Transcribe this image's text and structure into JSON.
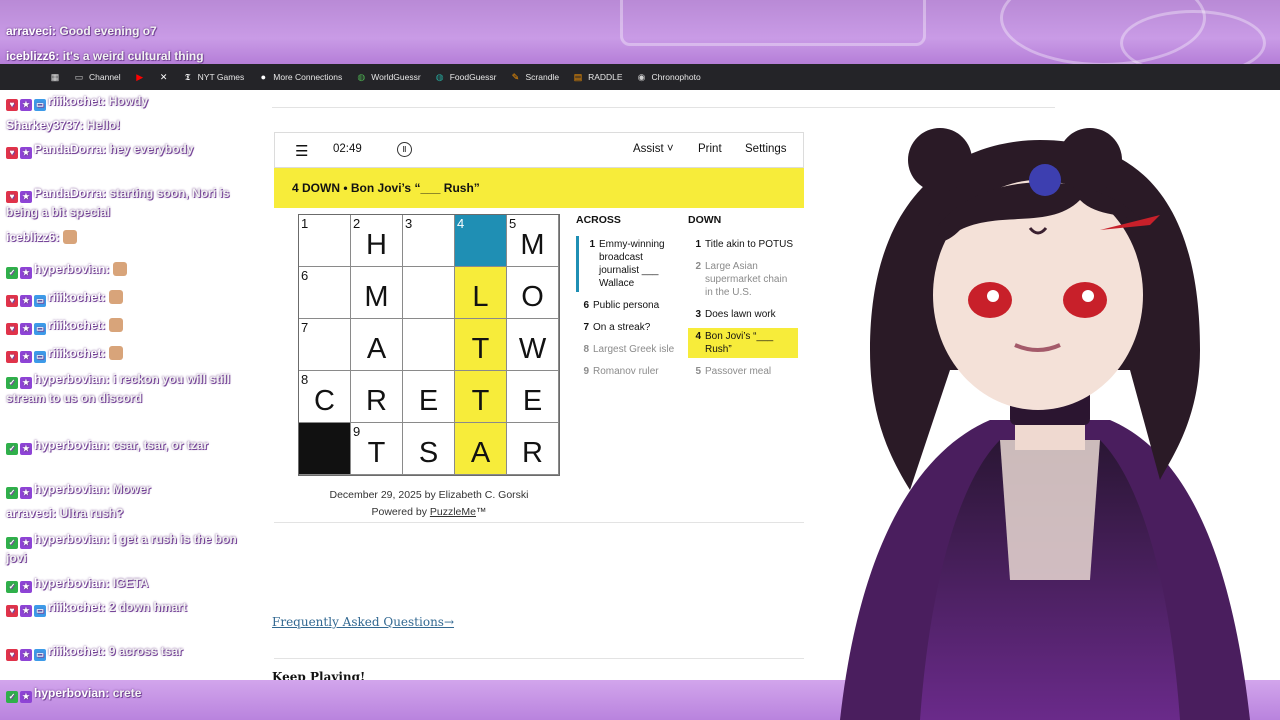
{
  "bookmarks": [
    {
      "icon": "folder-icon",
      "label": "Channel",
      "color": "#cfcfcf"
    },
    {
      "icon": "youtube-icon",
      "label": "",
      "color": "#ff0000"
    },
    {
      "icon": "x-icon",
      "label": "",
      "color": "#ffffff"
    },
    {
      "icon": "nyt-icon",
      "label": "NYT Games",
      "color": "#ffffff"
    },
    {
      "icon": "dot-icon",
      "label": "More Connections",
      "color": "#ffffff"
    },
    {
      "icon": "globe-icon",
      "label": "WorldGuessr",
      "color": "#4caf50"
    },
    {
      "icon": "globe-icon",
      "label": "FoodGuessr",
      "color": "#26a69a"
    },
    {
      "icon": "pen-icon",
      "label": "Scrandle",
      "color": "#ff9800"
    },
    {
      "icon": "raddle-icon",
      "label": "RADDLE",
      "color": "#ff9800"
    },
    {
      "icon": "camera-icon",
      "label": "Chronophoto",
      "color": "#cfcfcf"
    }
  ],
  "toolbar": {
    "timer": "02:49",
    "assist": "Assist ˅",
    "print": "Print",
    "settings": "Settings"
  },
  "clue_bar": "4 DOWN  •  Bon Jovi’s “___ Rush”",
  "grid": {
    "rows": [
      [
        {
          "n": "1",
          "l": "",
          "s": ""
        },
        {
          "n": "2",
          "l": "H",
          "s": ""
        },
        {
          "n": "3",
          "l": "",
          "s": ""
        },
        {
          "n": "4",
          "l": "",
          "s": "sel"
        },
        {
          "n": "5",
          "l": "M",
          "s": ""
        }
      ],
      [
        {
          "n": "6",
          "l": "",
          "s": ""
        },
        {
          "n": "",
          "l": "M",
          "s": ""
        },
        {
          "n": "",
          "l": "",
          "s": ""
        },
        {
          "n": "",
          "l": "L",
          "s": "hl"
        },
        {
          "n": "",
          "l": "O",
          "s": ""
        }
      ],
      [
        {
          "n": "7",
          "l": "",
          "s": ""
        },
        {
          "n": "",
          "l": "A",
          "s": ""
        },
        {
          "n": "",
          "l": "",
          "s": ""
        },
        {
          "n": "",
          "l": "T",
          "s": "hl"
        },
        {
          "n": "",
          "l": "W",
          "s": ""
        }
      ],
      [
        {
          "n": "8",
          "l": "C",
          "s": ""
        },
        {
          "n": "",
          "l": "R",
          "s": ""
        },
        {
          "n": "",
          "l": "E",
          "s": ""
        },
        {
          "n": "",
          "l": "T",
          "s": "hl"
        },
        {
          "n": "",
          "l": "E",
          "s": ""
        }
      ],
      [
        {
          "n": "",
          "l": "",
          "s": "black"
        },
        {
          "n": "9",
          "l": "T",
          "s": ""
        },
        {
          "n": "",
          "l": "S",
          "s": ""
        },
        {
          "n": "",
          "l": "A",
          "s": "hl"
        },
        {
          "n": "",
          "l": "R",
          "s": ""
        }
      ]
    ]
  },
  "byline": "December 29, 2025 by Elizabeth C. Gorski",
  "powered_prefix": "Powered by ",
  "powered_link": "PuzzleMe",
  "powered_suffix": "™",
  "across": {
    "title": "ACROSS",
    "clues": [
      {
        "n": "1",
        "t": "Emmy-winning broadcast journalist ___ Wallace",
        "state": "cur"
      },
      {
        "n": "6",
        "t": "Public persona",
        "state": ""
      },
      {
        "n": "7",
        "t": "On a streak?",
        "state": ""
      },
      {
        "n": "8",
        "t": "Largest Greek isle",
        "state": "done"
      },
      {
        "n": "9",
        "t": "Romanov ruler",
        "state": "done"
      }
    ]
  },
  "down": {
    "title": "DOWN",
    "clues": [
      {
        "n": "1",
        "t": "Title akin to POTUS",
        "state": ""
      },
      {
        "n": "2",
        "t": "Large Asian supermarket chain in the U.S.",
        "state": "done"
      },
      {
        "n": "3",
        "t": "Does lawn work",
        "state": ""
      },
      {
        "n": "4",
        "t": "Bon Jovi’s “___ Rush”",
        "state": "hl"
      },
      {
        "n": "5",
        "t": "Passover meal",
        "state": "done"
      }
    ]
  },
  "faq": "Frequently Asked Questions→",
  "keep_playing": "Keep Playing!",
  "chat": [
    {
      "user": "arraveci:",
      "text": "Good evening o7",
      "badges": []
    },
    {
      "user": "iceblizz6:",
      "text": "it's a weird cultural thing",
      "badges": []
    },
    {
      "user": "riiikochet:",
      "text": "Howdy",
      "badges": [
        "red",
        "purple",
        "blue"
      ]
    },
    {
      "user": "Sharkey3737:",
      "text": "Hello!",
      "badges": []
    },
    {
      "user": "PandaDorra:",
      "text": "hey everybody",
      "badges": [
        "red",
        "purple"
      ]
    },
    {
      "user": "PandaDorra:",
      "text": "starting soon, Nori is being a bit special",
      "badges": [
        "red",
        "purple"
      ]
    },
    {
      "user": "iceblizz6:",
      "text": "",
      "badges": []
    },
    {
      "user": "hyperbovian:",
      "text": "",
      "badges": [
        "green",
        "purple"
      ]
    },
    {
      "user": "riiikochet:",
      "text": "",
      "badges": [
        "red",
        "purple",
        "blue"
      ]
    },
    {
      "user": "riiikochet:",
      "text": "",
      "badges": [
        "red",
        "purple",
        "blue"
      ]
    },
    {
      "user": "riiikochet:",
      "text": "",
      "badges": [
        "red",
        "purple",
        "blue"
      ]
    },
    {
      "user": "hyperbovian:",
      "text": "i reckon you will still stream to us on discord",
      "badges": [
        "green",
        "purple"
      ]
    },
    {
      "user": "hyperbovian:",
      "text": "csar, tsar, or tzar",
      "badges": [
        "green",
        "purple"
      ]
    },
    {
      "user": "hyperbovian:",
      "text": "Mower",
      "badges": [
        "green",
        "purple"
      ]
    },
    {
      "user": "arraveci:",
      "text": "Ultra rush?",
      "badges": []
    },
    {
      "user": "hyperbovian:",
      "text": "i get a rush is the bon jovi",
      "badges": [
        "green",
        "purple"
      ]
    },
    {
      "user": "hyperbovian:",
      "text": "IGETA",
      "badges": [
        "green",
        "purple"
      ]
    },
    {
      "user": "riiikochet:",
      "text": "2 down hmart",
      "badges": [
        "red",
        "purple",
        "blue"
      ]
    },
    {
      "user": "riiikochet:",
      "text": "9 across tsar",
      "badges": [
        "red",
        "purple",
        "blue"
      ]
    },
    {
      "user": "hyperbovian:",
      "text": "crete",
      "badges": [
        "green",
        "purple"
      ]
    }
  ]
}
